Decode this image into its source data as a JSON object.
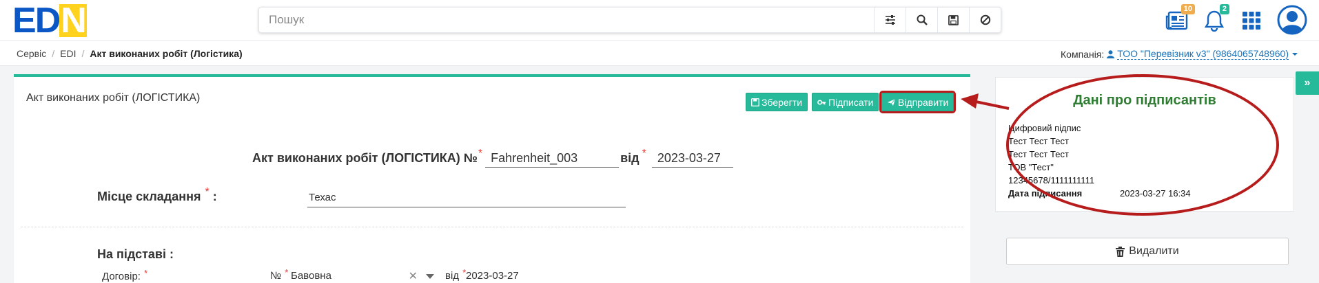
{
  "logo": {
    "letters": [
      "E",
      "D",
      "N"
    ]
  },
  "search": {
    "placeholder": "Пошук",
    "buttons": [
      "filter-icon",
      "search-icon",
      "save-icon",
      "clear-icon"
    ]
  },
  "header_icons": {
    "documents_badge": "10",
    "notifications_badge": "2",
    "documents_badge_color": "#f0ad4e",
    "notifications_badge_color": "#26b99a"
  },
  "breadcrumb": {
    "items": [
      "Сервіс",
      "EDI"
    ],
    "current": "Акт виконаних робіт (Логістика)"
  },
  "company": {
    "label": "Компанія:",
    "value": "ТОО \"Перевізник v3\" (9864065748960)"
  },
  "document": {
    "title": "Акт виконаних робіт (ЛОГІСТИКА)",
    "buttons": {
      "save": "Зберегти",
      "sign": "Підписати",
      "send": "Відправити"
    },
    "head_label": "Акт виконаних робіт (ЛОГІСТИКА) №",
    "number": "Fahrenheit_003",
    "from_label": "від",
    "date": "2023-03-27",
    "place_label": "Місце складання",
    "place_colon": ":",
    "place_value": "Техас",
    "basis_label": "На підставі :",
    "contract_label": "Договір:",
    "contract_no_label": "№",
    "contract_value": "Бавовна",
    "contract_from_label": "від",
    "contract_date": "2023-03-27",
    "required_mark": "*"
  },
  "signers": {
    "title": "Дані про підписантів",
    "lines": [
      "Цифровий підпис",
      "Тест Тест Тест",
      "Тест Тест Тест",
      "ТОВ \"Тест\"",
      "12345678/1111111111"
    ],
    "date_label": "Дата підписання",
    "date_value": "2023-03-27 16:34"
  },
  "delete_label": "Видалити",
  "colors": {
    "accent": "#26b99a",
    "highlight": "#b71c1c",
    "signer_title": "#2e7d32",
    "link": "#1a73b8"
  }
}
